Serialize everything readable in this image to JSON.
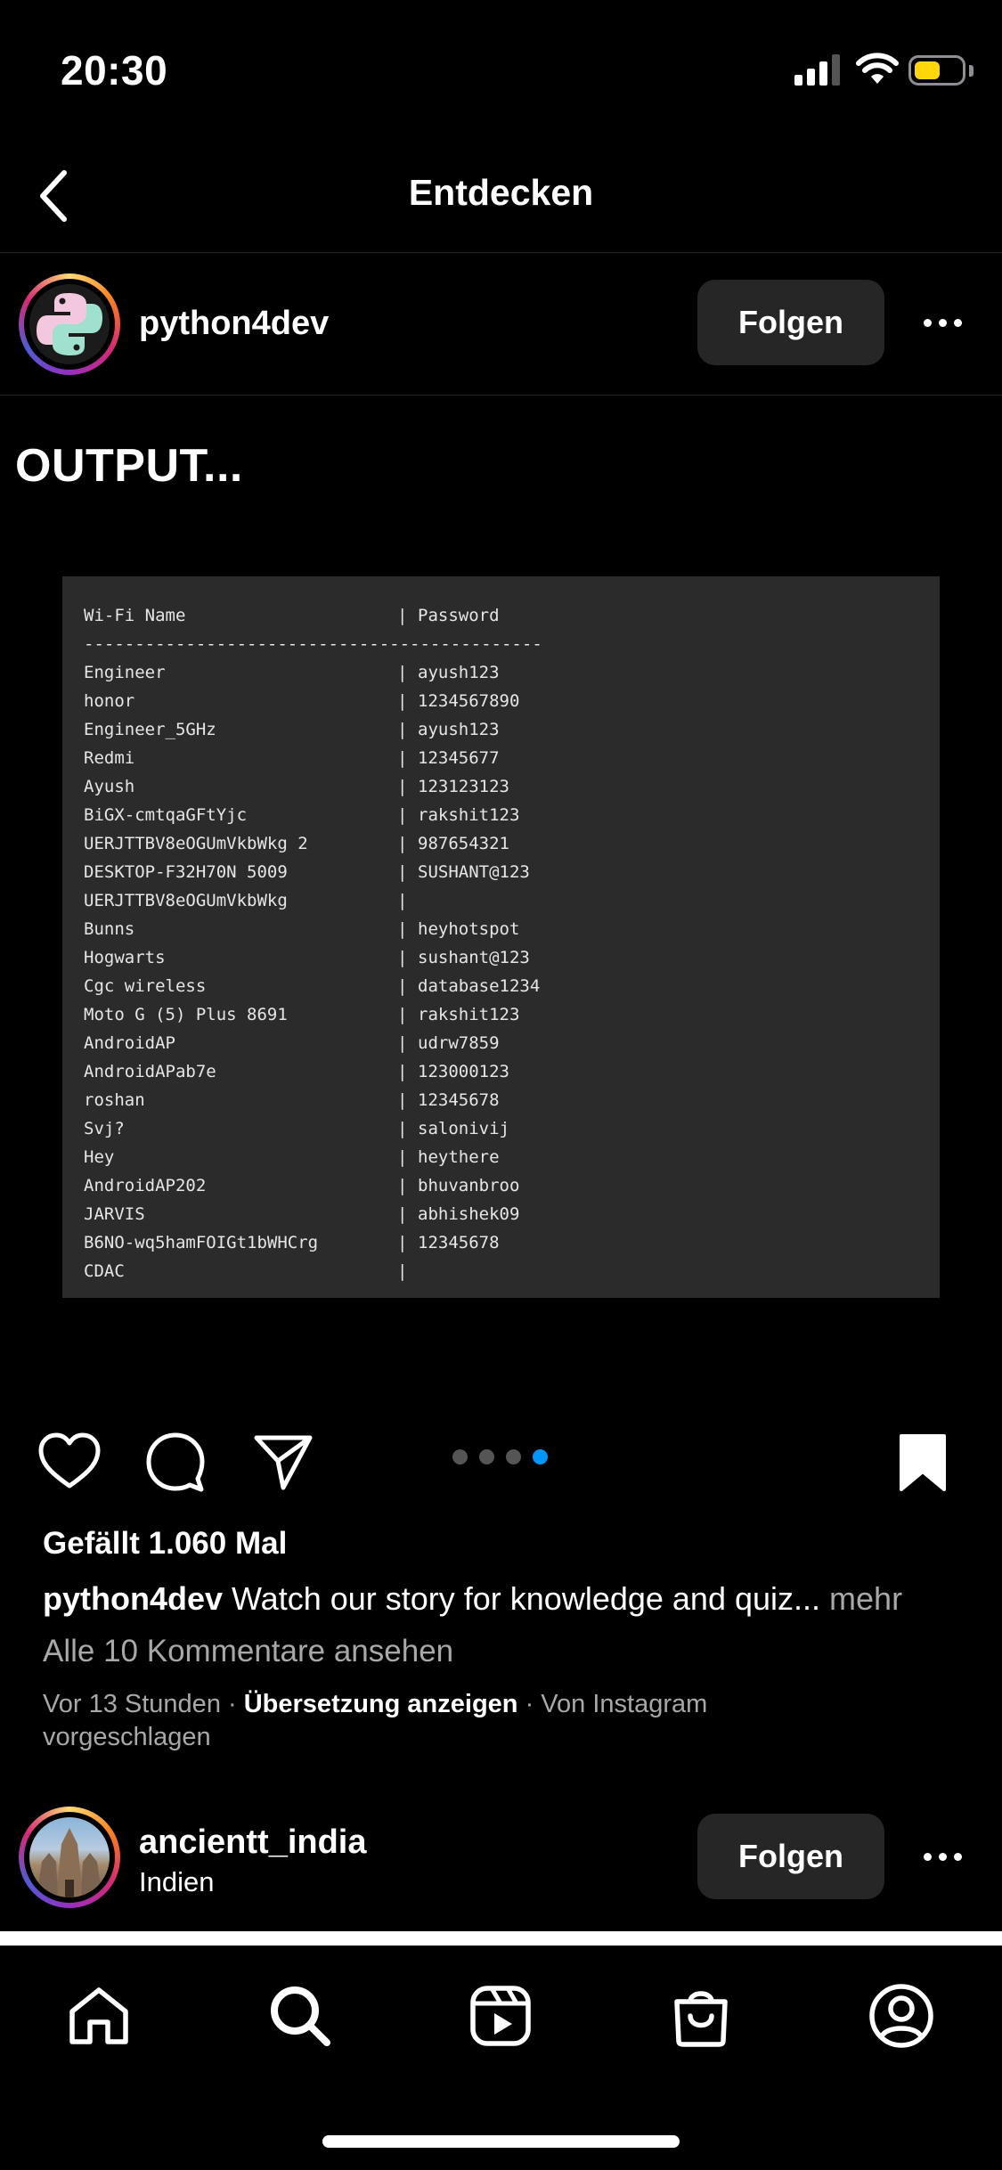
{
  "status_bar": {
    "time": "20:30"
  },
  "header": {
    "title": "Entdecken"
  },
  "post": {
    "username": "python4dev",
    "follow_label": "Folgen",
    "heading": "OUTPUT...",
    "code": {
      "header_name": "Wi-Fi Name",
      "header_password": "Password",
      "separator": "---------------------------------------------",
      "rows": [
        {
          "name": "Engineer",
          "password": "ayush123"
        },
        {
          "name": "honor",
          "password": "1234567890"
        },
        {
          "name": "Engineer_5GHz",
          "password": "ayush123"
        },
        {
          "name": "Redmi",
          "password": "12345677"
        },
        {
          "name": "Ayush",
          "password": "123123123"
        },
        {
          "name": "BiGX-cmtqaGFtYjc",
          "password": "rakshit123"
        },
        {
          "name": "UERJTTBV8eOGUmVkbWkg 2",
          "password": "987654321"
        },
        {
          "name": "DESKTOP-F32H70N 5009",
          "password": "SUSHANT@123"
        },
        {
          "name": "UERJTTBV8eOGUmVkbWkg",
          "password": ""
        },
        {
          "name": "Bunns",
          "password": "heyhotspot"
        },
        {
          "name": "Hogwarts",
          "password": "sushant@123"
        },
        {
          "name": "Cgc wireless",
          "password": "database1234"
        },
        {
          "name": "Moto G (5) Plus 8691",
          "password": "rakshit123"
        },
        {
          "name": "AndroidAP",
          "password": "udrw7859"
        },
        {
          "name": "AndroidAPab7e",
          "password": "123000123"
        },
        {
          "name": "roshan",
          "password": "12345678"
        },
        {
          "name": "Svj?",
          "password": "salonivij"
        },
        {
          "name": "Hey",
          "password": "heythere"
        },
        {
          "name": "AndroidAP202",
          "password": "bhuvanbroo"
        },
        {
          "name": "JARVIS",
          "password": "abhishek09"
        },
        {
          "name": "B6NO-wq5hamFOIGt1bWHCrg",
          "password": "12345678"
        },
        {
          "name": "CDAC",
          "password": ""
        }
      ]
    },
    "carousel": {
      "count": 4,
      "active_index": 3
    },
    "likes": "Gefällt 1.060 Mal",
    "caption_user": "python4dev",
    "caption_text": " Watch our story for knowledge and quiz...",
    "caption_more": " mehr",
    "comments_link": "Alle 10 Kommentare ansehen",
    "meta_time": "Vor 13 Stunden",
    "meta_sep": " · ",
    "meta_translate": "Übersetzung anzeigen",
    "meta_suggested": "Von Instagram vorgeschlagen"
  },
  "next_post": {
    "username": "ancientt_india",
    "location": "Indien",
    "follow_label": "Folgen"
  },
  "colors": {
    "background": "#000000",
    "button": "#262626",
    "accent_blue": "#0095f6",
    "muted_text": "#a8a8a8",
    "code_bg": "#2b2b2b"
  },
  "icons": {
    "header": "chevron-left-icon",
    "post_actions": [
      "heart-icon",
      "comment-icon",
      "share-icon",
      "bookmark-icon"
    ],
    "tabs": [
      "home-icon",
      "search-icon",
      "reels-icon",
      "shop-icon",
      "profile-icon"
    ]
  }
}
